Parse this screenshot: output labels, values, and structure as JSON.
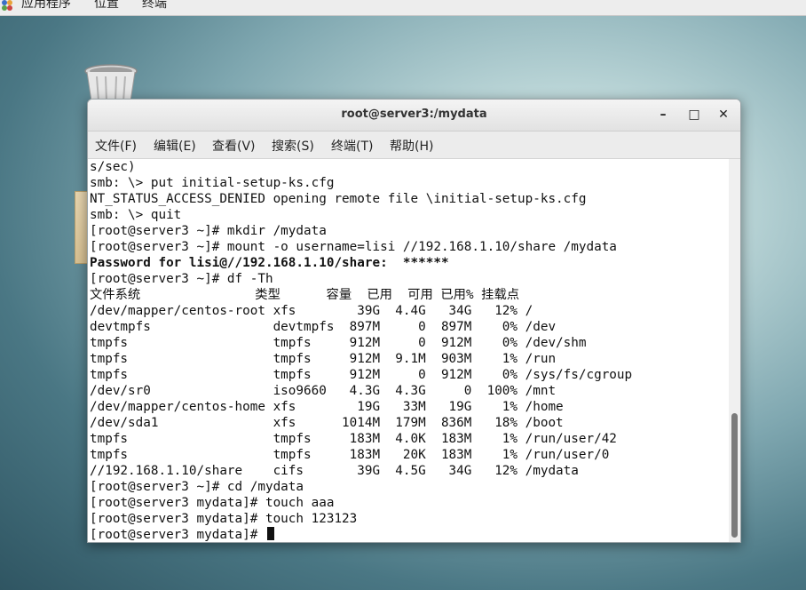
{
  "topbar": {
    "apps": "应用程序",
    "places": "位置",
    "terminal": "终端"
  },
  "window": {
    "title": "root@server3:/mydata",
    "minimize": "–",
    "maximize": "□",
    "close": "✕"
  },
  "menubar": {
    "file": "文件(F)",
    "edit": "编辑(E)",
    "view": "查看(V)",
    "search": "搜索(S)",
    "terminal": "终端(T)",
    "help": "帮助(H)"
  },
  "terminal": {
    "lines": [
      "s/sec)",
      "smb: \\> put initial-setup-ks.cfg",
      "NT_STATUS_ACCESS_DENIED opening remote file \\initial-setup-ks.cfg",
      "smb: \\> quit",
      "[root@server3 ~]# mkdir /mydata",
      "[root@server3 ~]# mount -o username=lisi //192.168.1.10/share /mydata",
      "Password for lisi@//192.168.1.10/share:  ******",
      "[root@server3 ~]# df -Th",
      "文件系统               类型      容量  已用  可用 已用% 挂载点",
      "/dev/mapper/centos-root xfs        39G  4.4G   34G   12% /",
      "devtmpfs                devtmpfs  897M     0  897M    0% /dev",
      "tmpfs                   tmpfs     912M     0  912M    0% /dev/shm",
      "tmpfs                   tmpfs     912M  9.1M  903M    1% /run",
      "tmpfs                   tmpfs     912M     0  912M    0% /sys/fs/cgroup",
      "/dev/sr0                iso9660   4.3G  4.3G     0  100% /mnt",
      "/dev/mapper/centos-home xfs        19G   33M   19G    1% /home",
      "/dev/sda1               xfs      1014M  179M  836M   18% /boot",
      "tmpfs                   tmpfs     183M  4.0K  183M    1% /run/user/42",
      "tmpfs                   tmpfs     183M   20K  183M    1% /run/user/0",
      "//192.168.1.10/share    cifs       39G  4.5G   34G   12% /mydata",
      "[root@server3 ~]# cd /mydata",
      "[root@server3 mydata]# touch aaa",
      "[root@server3 mydata]# touch 123123",
      "[root@server3 mydata]# "
    ]
  },
  "icons": {
    "apps": "apps-menu-icon",
    "trash": "trash-icon"
  }
}
